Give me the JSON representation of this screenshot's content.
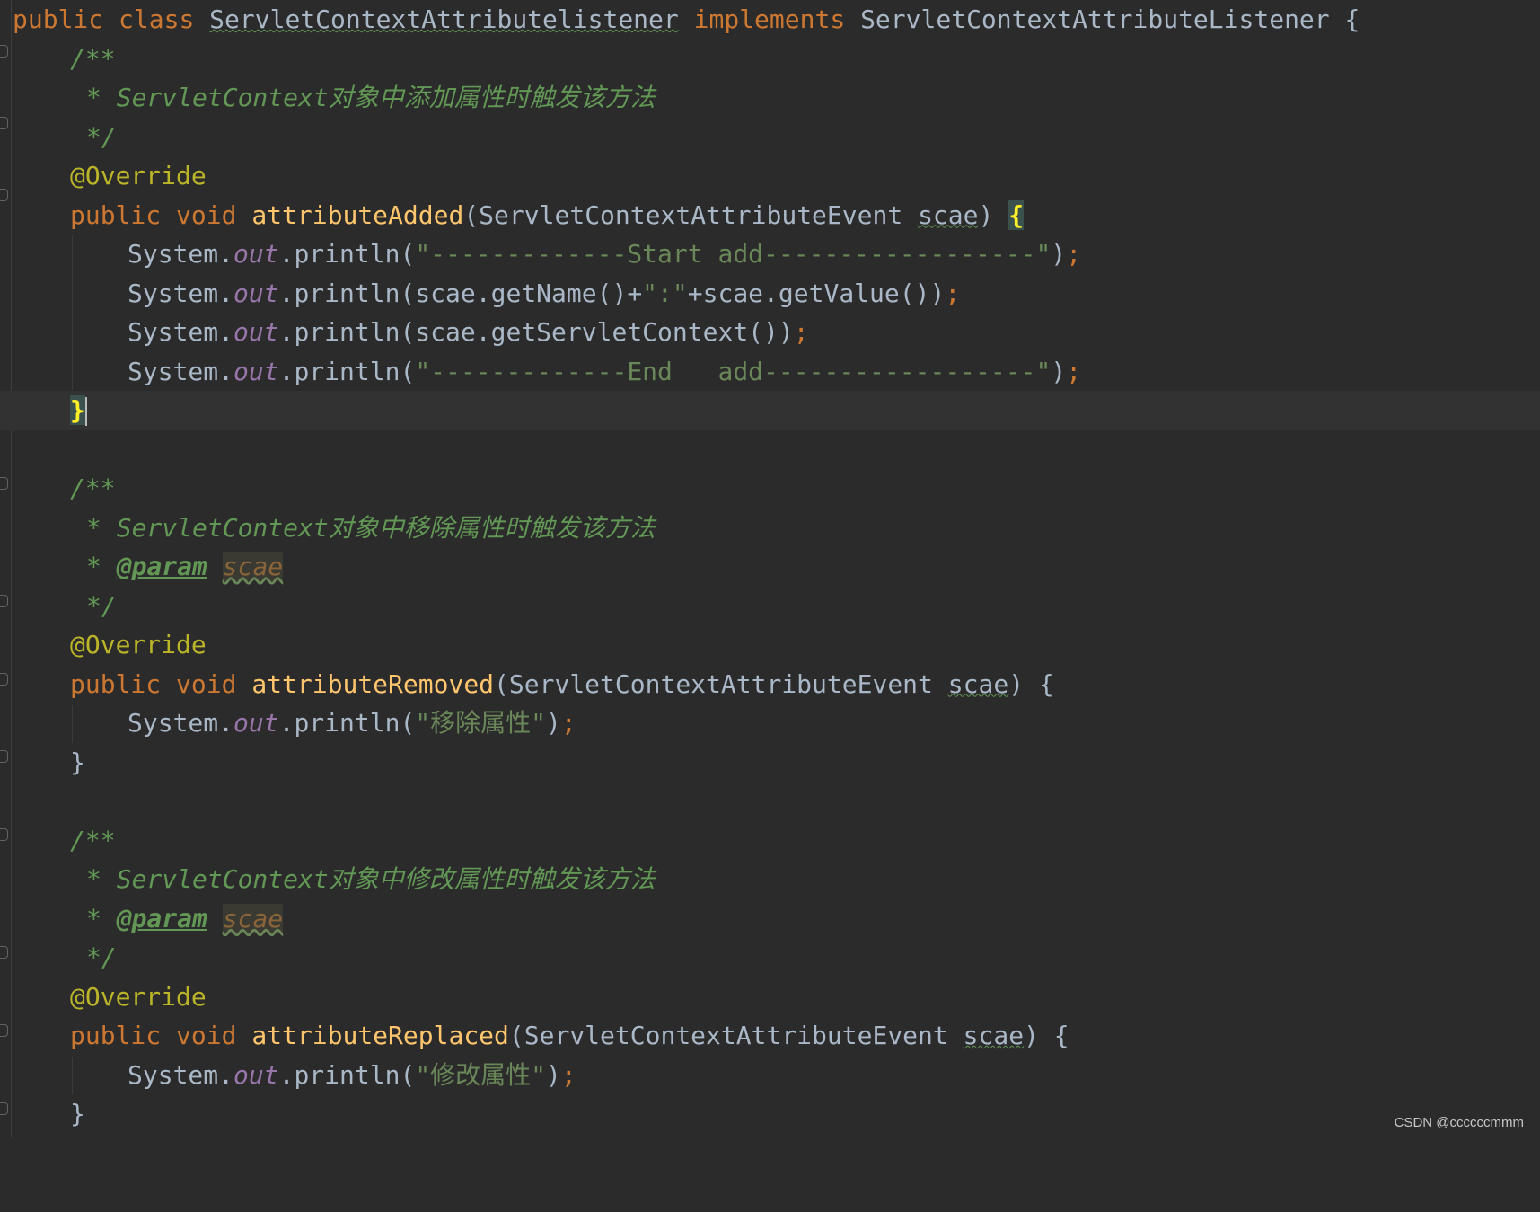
{
  "editor": {
    "class_decl": {
      "kw_public": "public",
      "kw_class": "class",
      "class_name": "ServletContextAttributelistener",
      "kw_implements": "implements",
      "interface_name": "ServletContextAttributeListener",
      "open_brace": "{"
    },
    "block_added": {
      "doc_open": "/**",
      "doc_desc_star": "* ",
      "doc_desc": "ServletContext对象中添加属性时触发该方法",
      "doc_close": "*/",
      "annotation": "@Override",
      "kw_public": "public",
      "kw_void": "void",
      "method_name": "attributeAdded",
      "param_open": "(ServletContextAttributeEvent ",
      "param_name": "scae",
      "param_close": ") ",
      "open_brace": "{",
      "stmt1_prefix": "System.",
      "stmt1_field": "out",
      "stmt1_call": ".println(",
      "stmt1_str": "\"-------------Start add------------------\"",
      "stmt1_end": ")",
      "stmt2_prefix": "System.",
      "stmt2_field": "out",
      "stmt2_call": ".println(scae.getName()+",
      "stmt2_str": "\":\"",
      "stmt2_end": "+scae.getValue())",
      "stmt3_prefix": "System.",
      "stmt3_field": "out",
      "stmt3_call": ".println(scae.getServletContext())",
      "stmt4_prefix": "System.",
      "stmt4_field": "out",
      "stmt4_call": ".println(",
      "stmt4_str": "\"-------------End   add------------------\"",
      "stmt4_end": ")",
      "semicolon": ";",
      "close_brace": "}"
    },
    "block_removed": {
      "doc_open": "/**",
      "doc_desc_star": "* ",
      "doc_desc": "ServletContext对象中移除属性时触发该方法",
      "doc_param_star": "* ",
      "doc_param_tag": "@param",
      "doc_param_name": "scae",
      "doc_close": "*/",
      "annotation": "@Override",
      "kw_public": "public",
      "kw_void": "void",
      "method_name": "attributeRemoved",
      "param_open": "(ServletContextAttributeEvent ",
      "param_name": "scae",
      "param_close": ") {",
      "stmt_prefix": "System.",
      "stmt_field": "out",
      "stmt_call": ".println(",
      "stmt_str": "\"移除属性\"",
      "stmt_end": ")",
      "semicolon": ";",
      "close_brace": "}"
    },
    "block_replaced": {
      "doc_open": "/**",
      "doc_desc_star": "* ",
      "doc_desc": "ServletContext对象中修改属性时触发该方法",
      "doc_param_star": "* ",
      "doc_param_tag": "@param",
      "doc_param_name": "scae",
      "doc_close": "*/",
      "annotation": "@Override",
      "kw_public": "public",
      "kw_void": "void",
      "method_name": "attributeReplaced",
      "param_open": "(ServletContextAttributeEvent ",
      "param_name": "scae",
      "param_close": ") {",
      "stmt_prefix": "System.",
      "stmt_field": "out",
      "stmt_call": ".println(",
      "stmt_str": "\"修改属性\"",
      "stmt_end": ")",
      "semicolon": ";",
      "close_brace": "}"
    }
  },
  "watermark": "CSDN @ccccccmmm",
  "colors": {
    "background": "#2b2b2b",
    "keyword": "#cc7832",
    "method": "#ffc66d",
    "annotation": "#bbb529",
    "comment": "#629755",
    "string": "#6a8759",
    "field": "#9876aa",
    "text": "#a9b7c6"
  }
}
